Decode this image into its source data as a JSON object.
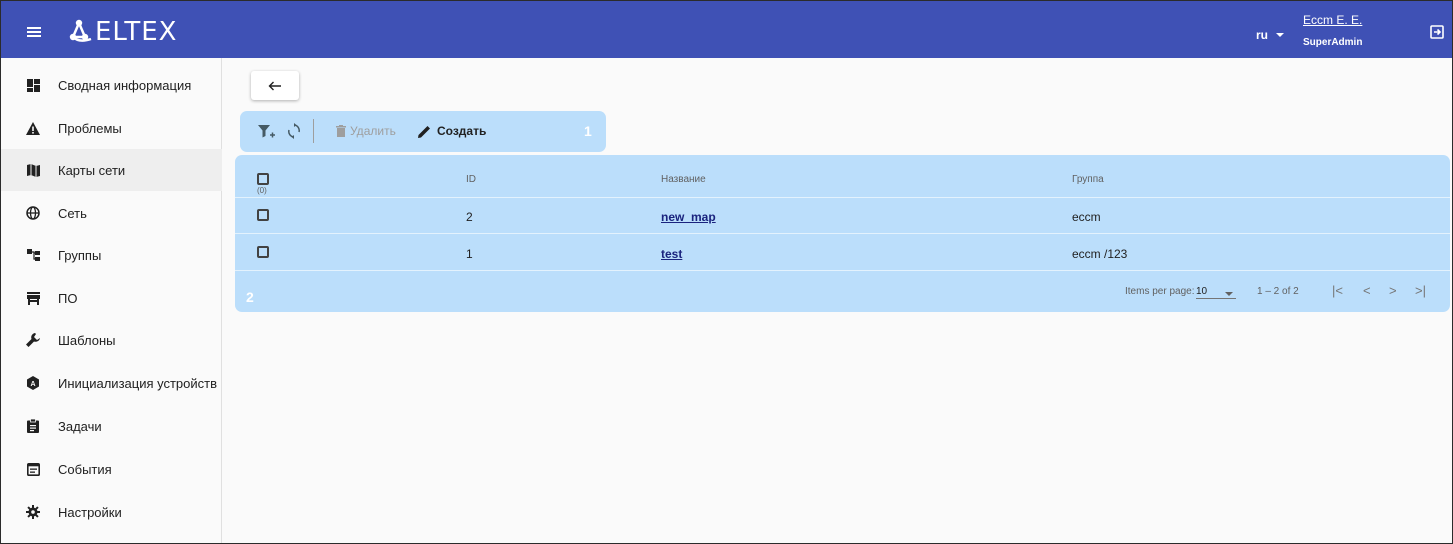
{
  "header": {
    "brand": "ELTEX",
    "language": "ru",
    "user_name": "Eccm E. E.",
    "user_role": "SuperAdmin",
    "color": "#3f51b5"
  },
  "sidebar": {
    "items": [
      {
        "label": "Сводная информация",
        "icon": "dashboard-icon"
      },
      {
        "label": "Проблемы",
        "icon": "warning-icon"
      },
      {
        "label": "Карты сети",
        "icon": "map-icon",
        "active": true
      },
      {
        "label": "Сеть",
        "icon": "globe-icon"
      },
      {
        "label": "Группы",
        "icon": "hierarchy-icon"
      },
      {
        "label": "ПО",
        "icon": "store-icon"
      },
      {
        "label": "Шаблоны",
        "icon": "wrench-icon"
      },
      {
        "label": "Инициализация устройств",
        "icon": "device-init-icon"
      },
      {
        "label": "Задачи",
        "icon": "clipboard-icon"
      },
      {
        "label": "События",
        "icon": "event-list-icon"
      },
      {
        "label": "Настройки",
        "icon": "gear-icon"
      }
    ]
  },
  "toolbar": {
    "delete_label": "Удалить",
    "create_label": "Создать",
    "marker": "1",
    "color": "#bbdefb"
  },
  "table": {
    "header": {
      "select_count": "(0)",
      "id": "ID",
      "name": "Название",
      "group": "Группа"
    },
    "rows": [
      {
        "id": "2",
        "name": "new_map",
        "group": "eccm"
      },
      {
        "id": "1",
        "name": "test",
        "group": "eccm /123"
      }
    ],
    "marker": "2"
  },
  "pagination": {
    "items_per_page_label": "Items per page:",
    "items_per_page_value": "10",
    "range": "1 – 2 of 2"
  }
}
